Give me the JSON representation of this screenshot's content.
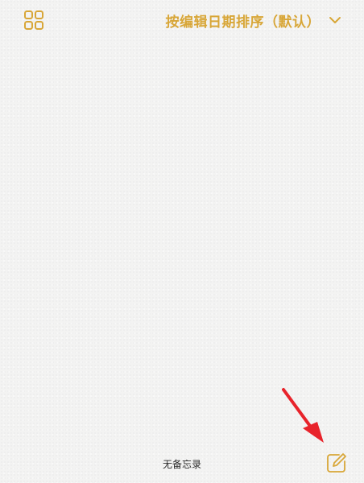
{
  "header": {
    "grid_icon": "grid-four-squares-icon",
    "sort_label": "按编辑日期排序（默认）",
    "sort_icon": "chevron-down-icon"
  },
  "footer": {
    "note_count": "无备忘录",
    "new_note_icon": "compose-note-icon"
  },
  "annotation": {
    "arrow_icon": "red-arrow-icon"
  },
  "colors": {
    "accent": "#d8a637",
    "background": "#f3f3f2",
    "text": "#2b2b2b",
    "arrow": "#e8232b"
  }
}
